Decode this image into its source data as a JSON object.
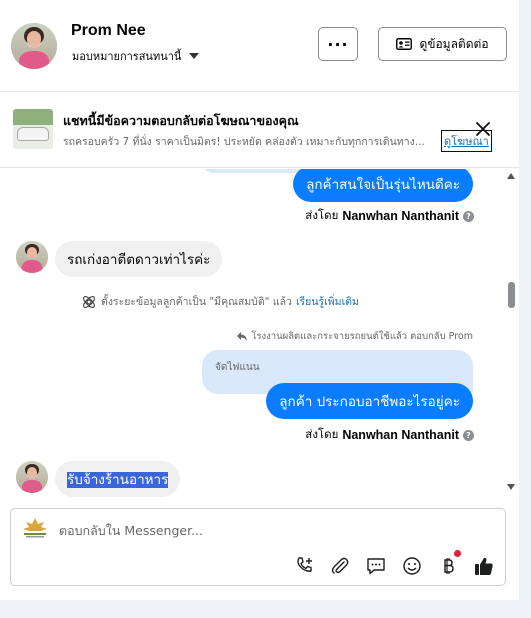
{
  "header": {
    "name": "Prom Nee",
    "assign_label": "มอบหมายการสนทนานี้",
    "more_label": "···",
    "contact_button": "ดูข้อมูลติดต่อ"
  },
  "ad": {
    "title": "แชทนี้มีข้อความตอบกลับต่อโฆษณาของคุณ",
    "description": "รถครอบครัว 7 ที่นั่ง ราคาเป็นมิตร! ประหยัด คล่องตัว เหมาะกับทุกการเดินทาง...",
    "link": "ดูโฆษณา"
  },
  "messages": {
    "m1_text": "ลูกค้าสนใจเป็นรุ่นไหนดีคะ",
    "m1_sent_prefix": "ส่งโดย",
    "m1_sender": "Nanwhan Nanthanit",
    "m2_text": "รถเก่งอาตีตดาวเท่าไรค่ะ",
    "system_text": "ตั้งระยะข้อมูลลูกค้าเป็น \"มีคุณสมบัติ\" แล้ว",
    "system_link": "เรียนรู้เพิ่มเติม",
    "reply_note": "โรงงานผลิตและกระจายรถยนต์ใช้แล้ว ตอบกลับ Prom",
    "quoted_text": "จัดไฟแนน",
    "m3_text": "ลูกค้า  ประกอบอาชีพอะไรอยู่คะ",
    "m3_sent_prefix": "ส่งโดย",
    "m3_sender": "Nanwhan Nanthanit",
    "m4_text": "รับจ้างร้านอาหาร"
  },
  "composer": {
    "placeholder": "ตอบกลับใน Messenger..."
  },
  "icons": [
    "chevron-down-icon",
    "contact-card-icon",
    "close-icon",
    "info-icon",
    "reply-icon",
    "help-icon",
    "add-call-icon",
    "attach-icon",
    "saved-replies-icon",
    "emoji-icon",
    "payment-icon",
    "thumbs-up-icon"
  ],
  "colors": {
    "accent": "#0a7cff",
    "link": "#1a6fb5",
    "incoming": "#f0f0f0",
    "quoted": "#d9e8fb",
    "highlight": "#3b66d9"
  }
}
